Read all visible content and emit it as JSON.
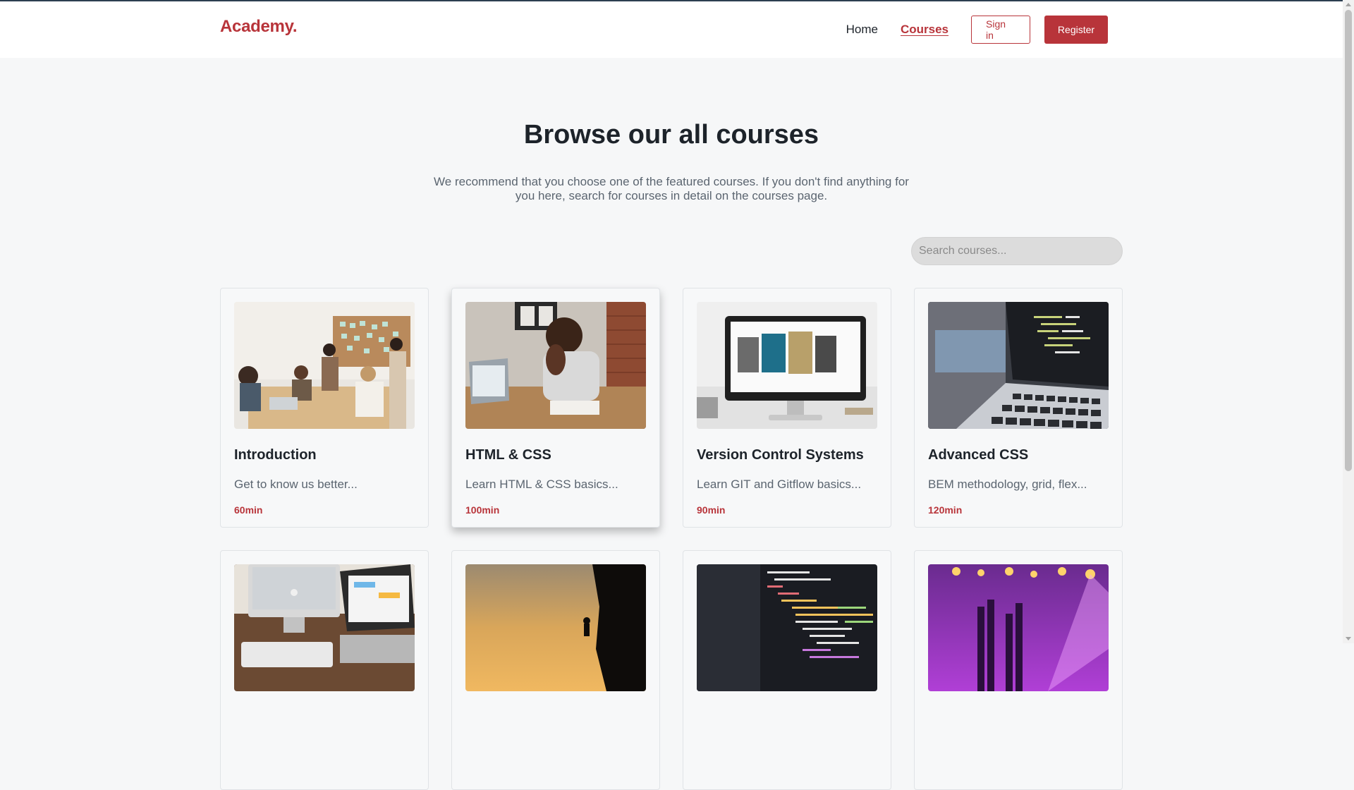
{
  "header": {
    "logo_text": "Academy",
    "logo_dot": ".",
    "nav": [
      {
        "label": "Home"
      },
      {
        "label": "Courses"
      }
    ],
    "signin_label": "Sign in",
    "register_label": "Register"
  },
  "hero": {
    "title": "Browse our all courses",
    "subtitle": "We recommend that you choose one of the featured courses. If you don't find anything for you here, search for courses in detail on the courses page."
  },
  "search": {
    "placeholder": "Search courses..."
  },
  "courses": [
    {
      "title": "Introduction",
      "description": "Get to know us better...",
      "duration": "60min",
      "image": "team-meeting-photo"
    },
    {
      "title": "HTML & CSS",
      "description": "Learn HTML & CSS basics...",
      "duration": "100min",
      "image": "man-at-laptop-photo"
    },
    {
      "title": "Version Control Systems",
      "description": "Learn GIT and Gitflow basics...",
      "duration": "90min",
      "image": "monitor-photo"
    },
    {
      "title": "Advanced CSS",
      "description": "BEM methodology, grid, flex...",
      "duration": "120min",
      "image": "laptop-code-photo"
    },
    {
      "title": "",
      "description": "",
      "duration": "",
      "image": "imac-desk-photo"
    },
    {
      "title": "",
      "description": "",
      "duration": "",
      "image": "climber-sunset-photo"
    },
    {
      "title": "",
      "description": "",
      "duration": "",
      "image": "code-editor-photo"
    },
    {
      "title": "",
      "description": "",
      "duration": "",
      "image": "concert-lights-photo"
    }
  ],
  "colors": {
    "brand": "#b8343a",
    "background": "#f6f7f8",
    "text": "#1d232a",
    "muted": "#5b6570"
  }
}
